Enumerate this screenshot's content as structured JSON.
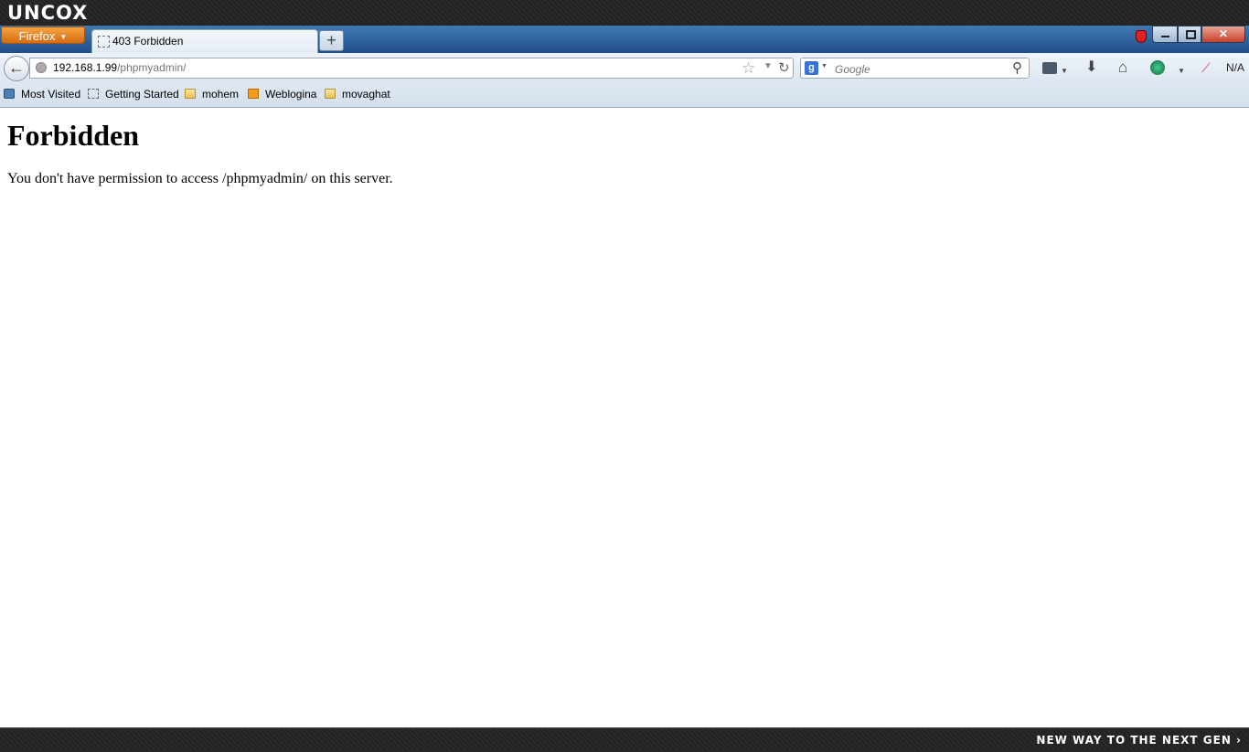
{
  "theme": {
    "logo_text": "UNCOX",
    "slogan": "NEW WAY TO THE NEXT GEN ›"
  },
  "browser": {
    "menu_button": "Firefox",
    "tab_title": "403 Forbidden",
    "new_tab_label": "+",
    "url_host": "192.168.1.99",
    "url_path": "/phpmyadmin/",
    "search_placeholder": "Google",
    "search_engine_letter": "g",
    "addon_text": "N/A"
  },
  "bookmarks": [
    {
      "label": "Most Visited"
    },
    {
      "label": "Getting Started"
    },
    {
      "label": "mohem"
    },
    {
      "label": "Weblogina"
    },
    {
      "label": "movaghat"
    }
  ],
  "page": {
    "title": "Forbidden",
    "message": "You don't have permission to access /phpmyadmin/ on this server."
  },
  "colors": {
    "tabstrip": "#1f4f8b",
    "firefox_button": "#e8841f",
    "close_button": "#c8412a"
  }
}
